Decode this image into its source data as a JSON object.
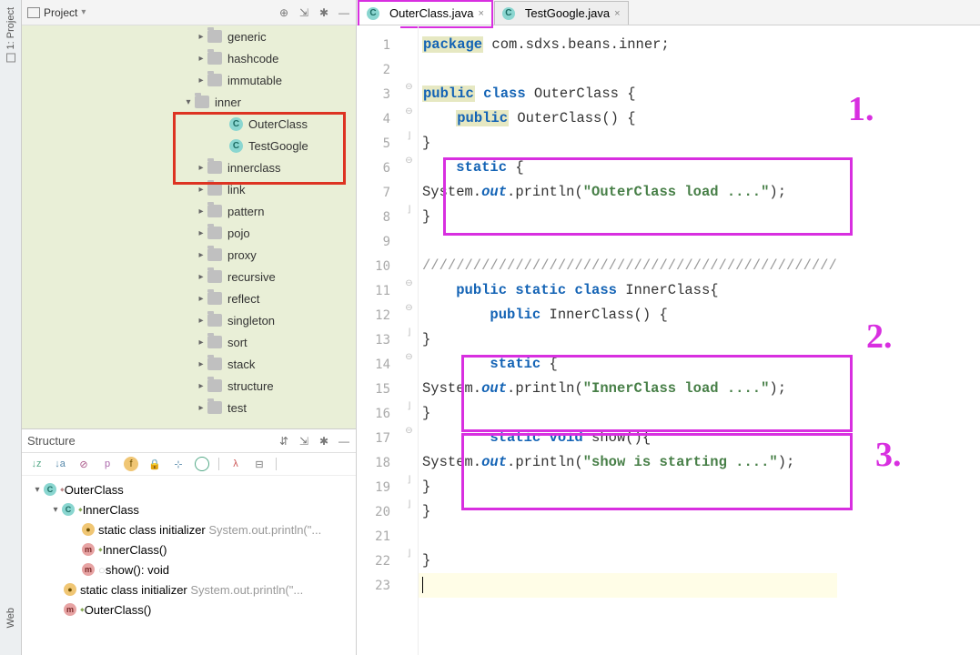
{
  "sidebar_left": {
    "project_label": "1: Project",
    "web_label": "Web"
  },
  "project_panel": {
    "title": "Project",
    "folders": [
      "generic",
      "hashcode",
      "immutable",
      "inner",
      "innerclass",
      "link",
      "pattern",
      "pojo",
      "proxy",
      "recursive",
      "reflect",
      "singleton",
      "sort",
      "stack",
      "structure",
      "test"
    ],
    "inner_children": [
      "OuterClass",
      "TestGoogle"
    ]
  },
  "structure_panel": {
    "title": "Structure",
    "root": "OuterClass",
    "inner": "InnerClass",
    "items": [
      {
        "label": "static class initializer",
        "gray": "System.out.println(\"..."
      },
      {
        "label": "InnerClass()",
        "gray": ""
      },
      {
        "label": "show(): void",
        "gray": ""
      }
    ],
    "outer_items": [
      {
        "label": "static class initializer",
        "gray": "System.out.println(\"..."
      },
      {
        "label": "OuterClass()",
        "gray": ""
      }
    ]
  },
  "tabs": [
    {
      "name": "OuterClass.java",
      "active": true
    },
    {
      "name": "TestGoogle.java",
      "active": false
    }
  ],
  "code": {
    "l1": {
      "kw": "package",
      "rest": " com.sdxs.beans.inner;"
    },
    "l3": {
      "kw1": "public",
      "kw2": " class",
      "rest": " OuterClass {"
    },
    "l4": {
      "kw": "public",
      "rest": " OuterClass() {"
    },
    "l5": "    }",
    "l6": {
      "kw": "static",
      "rest": " {"
    },
    "l7": {
      "pre": "        System.",
      "out": "out",
      "mid": ".println(",
      "str": "\"OuterClass load ....\"",
      "end": ");"
    },
    "l8": "    }",
    "l10": "    /////////////////////////////////////////////////",
    "l11": {
      "kw1": "public static",
      "kw2": " class",
      "rest": " InnerClass{"
    },
    "l12": {
      "kw": "public",
      "rest": " InnerClass() {"
    },
    "l13": "        }",
    "l14": {
      "kw": "static",
      "rest": " {"
    },
    "l15": {
      "pre": "            System.",
      "out": "out",
      "mid": ".println(",
      "str": "\"InnerClass load ....\"",
      "end": ");"
    },
    "l16": "        }",
    "l17": {
      "kw": "static void",
      "rest": " show(){"
    },
    "l18": {
      "pre": "            System.",
      "out": "out",
      "mid": ".println(",
      "str": "\"show is starting ....\"",
      "end": ");"
    },
    "l19": "        }",
    "l20": "    }",
    "l22": "}"
  },
  "annotations": {
    "n1": "1.",
    "n2": "2.",
    "n3": "3."
  }
}
